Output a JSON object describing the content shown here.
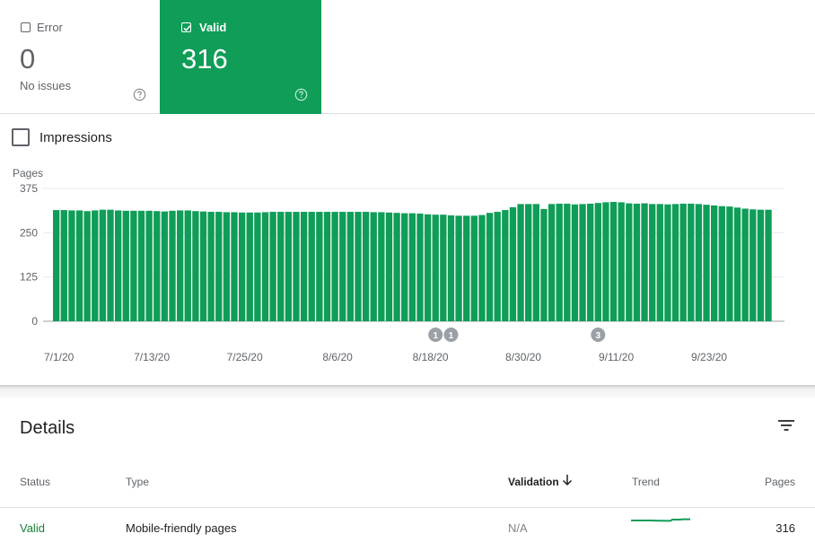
{
  "cards": {
    "error": {
      "label": "Error",
      "count": "0",
      "subtitle": "No issues"
    },
    "valid": {
      "label": "Valid",
      "count": "316"
    }
  },
  "toggle": {
    "impressions_label": "Impressions"
  },
  "chart_data": {
    "type": "bar",
    "ylabel": "Pages",
    "ylim": [
      0,
      375
    ],
    "yticks": [
      0,
      125,
      250,
      375
    ],
    "bar_color": "#0f9d58",
    "x_tick_labels": [
      "7/1/20",
      "7/13/20",
      "7/25/20",
      "8/6/20",
      "8/18/20",
      "8/30/20",
      "9/11/20",
      "9/23/20"
    ],
    "x_tick_indices": [
      0,
      12,
      24,
      36,
      48,
      60,
      72,
      84
    ],
    "values": [
      314,
      314,
      313,
      313,
      311,
      313,
      315,
      315,
      313,
      312,
      312,
      312,
      312,
      311,
      310,
      312,
      313,
      313,
      311,
      310,
      309,
      309,
      308,
      308,
      307,
      307,
      307,
      308,
      309,
      309,
      309,
      309,
      309,
      309,
      309,
      309,
      309,
      309,
      309,
      309,
      309,
      308,
      308,
      307,
      306,
      305,
      305,
      304,
      302,
      301,
      301,
      299,
      298,
      298,
      298,
      300,
      306,
      309,
      314,
      322,
      331,
      331,
      331,
      317,
      331,
      332,
      332,
      330,
      331,
      332,
      334,
      336,
      337,
      336,
      333,
      332,
      333,
      331,
      331,
      330,
      331,
      332,
      332,
      331,
      329,
      327,
      325,
      324,
      321,
      318,
      316,
      315,
      315
    ],
    "annotations": [
      {
        "index": 49,
        "label": "1"
      },
      {
        "index": 51,
        "label": "1"
      },
      {
        "index": 70,
        "label": "3"
      }
    ]
  },
  "details": {
    "title": "Details",
    "columns": {
      "status": "Status",
      "type": "Type",
      "validation": "Validation",
      "trend": "Trend",
      "pages": "Pages"
    },
    "rows": [
      {
        "status": "Valid",
        "type": "Mobile-friendly pages",
        "validation": "N/A",
        "pages": "316"
      }
    ]
  },
  "icons": {
    "error_checkbox": "checkbox-empty-icon",
    "valid_checkbox": "checkbox-checked-icon",
    "help": "help-circle-icon",
    "filter": "filter-icon",
    "sort": "arrow-down-icon"
  },
  "colors": {
    "valid_green": "#0f9d58",
    "status_green": "#188038"
  }
}
